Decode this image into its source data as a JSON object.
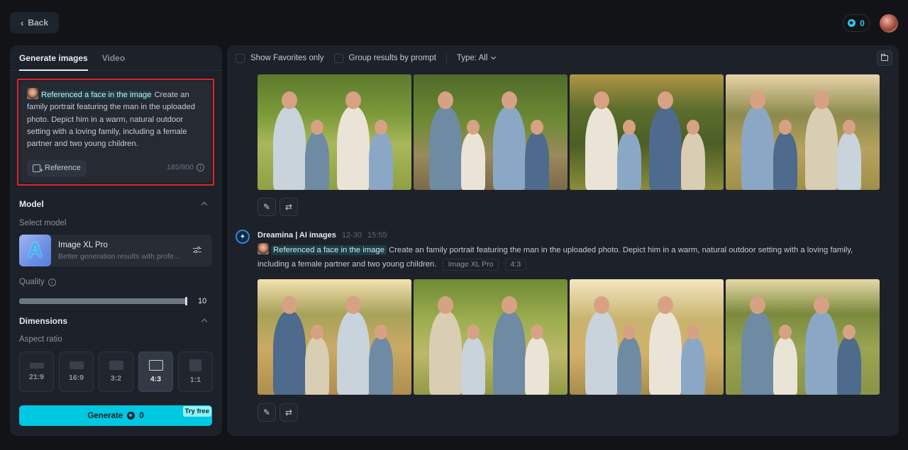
{
  "header": {
    "back_label": "Back",
    "credits": "0",
    "accent_color": "#36c5ea"
  },
  "left_panel": {
    "tabs": [
      {
        "label": "Generate images",
        "active": true
      },
      {
        "label": "Video",
        "active": false
      }
    ],
    "prompt": {
      "reference_chip": "Referenced a face in the image",
      "text": "Create an family portrait featuring the man in the uploaded photo. Depict him in a warm, natural outdoor setting with a loving family, including a female partner and two young children.",
      "reference_button": "Reference",
      "char_count": "185/800",
      "highlight_color": "#e0232e"
    },
    "model": {
      "section_title": "Model",
      "select_label": "Select model",
      "thumb_letter": "A",
      "name": "Image XL Pro",
      "description": "Better generation results with profe..."
    },
    "quality": {
      "label": "Quality",
      "value": 10,
      "max": 10,
      "fraction": 1.0
    },
    "dimensions": {
      "section_title": "Dimensions",
      "aspect_label": "Aspect ratio",
      "ratios": [
        {
          "label": "21:9",
          "active": false
        },
        {
          "label": "16:9",
          "active": false
        },
        {
          "label": "3:2",
          "active": false
        },
        {
          "label": "4:3",
          "active": true
        },
        {
          "label": "1:1",
          "active": false
        }
      ]
    },
    "generate": {
      "label": "Generate",
      "cost": "0",
      "badge": "Try free",
      "color": "#00c8e0"
    }
  },
  "main": {
    "toolbar": {
      "favorites_label": "Show Favorites only",
      "group_label": "Group results by prompt",
      "type_label": "Type: All"
    },
    "results": [
      {
        "images": [
          "family-portrait-1",
          "family-portrait-2",
          "family-portrait-3",
          "family-portrait-4"
        ]
      },
      {
        "author": "Dreamina | AI images",
        "date": "12-30",
        "time": "15:55",
        "reference_chip": "Referenced a face in the image",
        "prompt": "Create an family portrait featuring the man in the uploaded photo. Depict him in a warm, natural outdoor setting with a loving family, including a female partner and two young children.",
        "tags": [
          "Image XL Pro",
          "4:3"
        ],
        "images": [
          "family-portrait-5",
          "family-portrait-6",
          "family-portrait-7",
          "family-portrait-8"
        ]
      }
    ]
  }
}
